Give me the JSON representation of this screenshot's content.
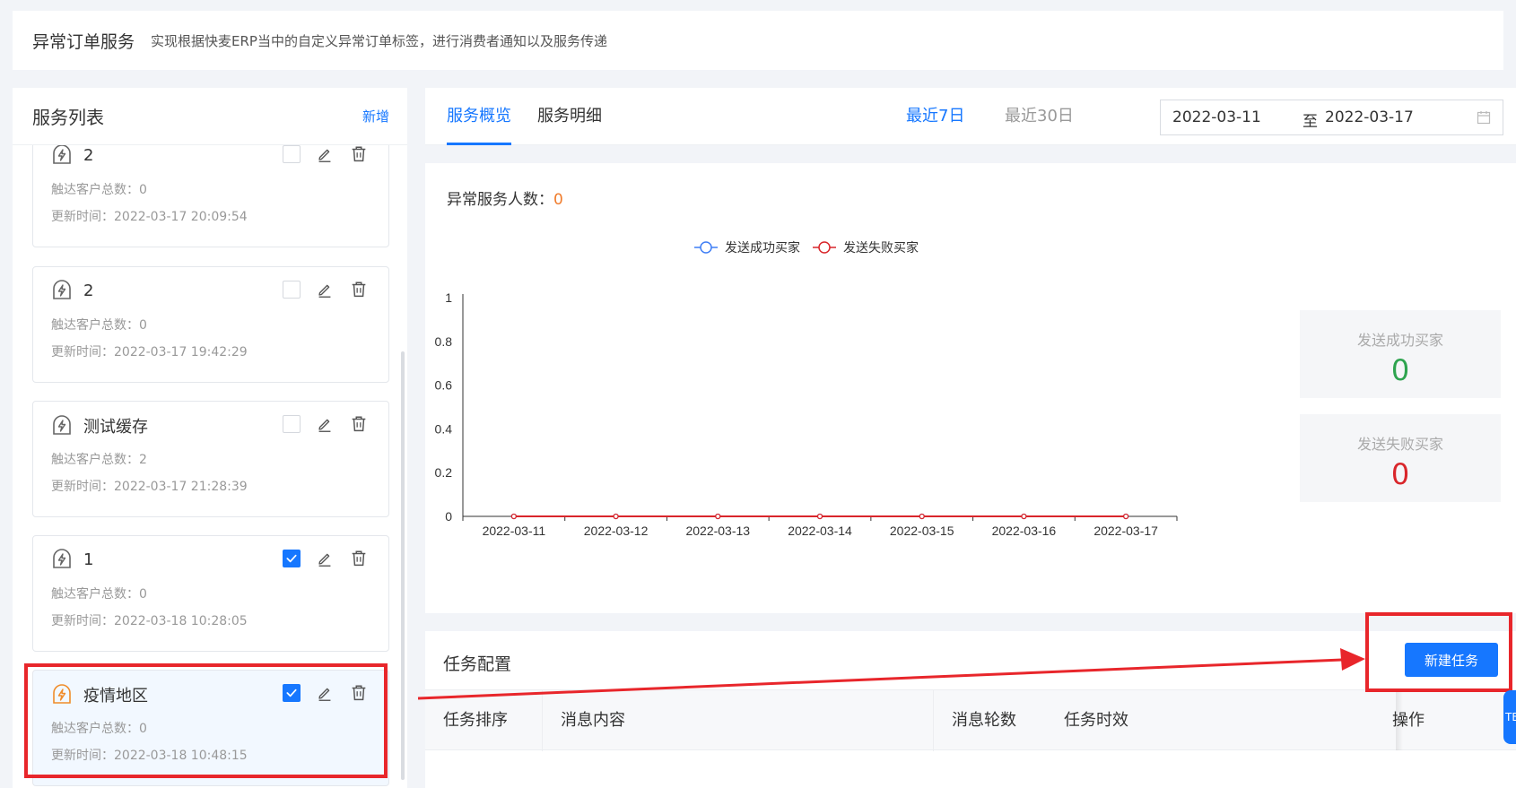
{
  "header": {
    "title": "异常订单服务",
    "description": "实现根据快麦ERP当中的自定义异常订单标签，进行消费者通知以及服务传递"
  },
  "service_list": {
    "title": "服务列表",
    "add_label": "新增",
    "count_label": "触达客户总数：",
    "time_label": "更新时间：",
    "items": [
      {
        "name": "2",
        "customers": "0",
        "updated": "2022-03-17 20:09:54",
        "checked": false
      },
      {
        "name": "2",
        "customers": "0",
        "updated": "2022-03-17 19:42:29",
        "checked": false
      },
      {
        "name": "测试缓存",
        "customers": "2",
        "updated": "2022-03-17 21:28:39",
        "checked": false
      },
      {
        "name": "1",
        "customers": "0",
        "updated": "2022-03-18 10:28:05",
        "checked": true
      },
      {
        "name": "疫情地区",
        "customers": "0",
        "updated": "2022-03-18 10:48:15",
        "checked": true
      }
    ]
  },
  "tabs": [
    {
      "label": "服务概览",
      "active": true
    },
    {
      "label": "服务明细",
      "active": false
    }
  ],
  "ranges": {
    "last7": "最近7日",
    "last30": "最近30日"
  },
  "date_range": {
    "start": "2022-03-11",
    "separator": "至",
    "end": "2022-03-17"
  },
  "stats": {
    "label": "异常服务人数：",
    "value": "0",
    "success_label": "发送成功买家",
    "success_value": "0",
    "fail_label": "发送失败买家",
    "fail_value": "0"
  },
  "chart_data": {
    "type": "line",
    "categories": [
      "2022-03-11",
      "2022-03-12",
      "2022-03-13",
      "2022-03-14",
      "2022-03-15",
      "2022-03-16",
      "2022-03-17"
    ],
    "series": [
      {
        "name": "发送成功买家",
        "color": "#3f7ef5",
        "values": [
          0,
          0,
          0,
          0,
          0,
          0,
          0
        ]
      },
      {
        "name": "发送失败买家",
        "color": "#d9262b",
        "values": [
          0,
          0,
          0,
          0,
          0,
          0,
          0
        ]
      }
    ],
    "ylim": [
      0,
      1
    ],
    "yticks": [
      "0",
      "0.2",
      "0.4",
      "0.6",
      "0.8",
      "1"
    ],
    "legend": "top-center"
  },
  "task": {
    "title": "任务配置",
    "new_button": "新建任务",
    "columns": [
      "任务排序",
      "消息内容",
      "消息轮数",
      "任务时效",
      "操作"
    ]
  },
  "float_tab": "TB",
  "colors": {
    "accent": "#1677ff",
    "success": "#2ea44f",
    "danger": "#d9262b",
    "highlight": "#e8262b"
  }
}
